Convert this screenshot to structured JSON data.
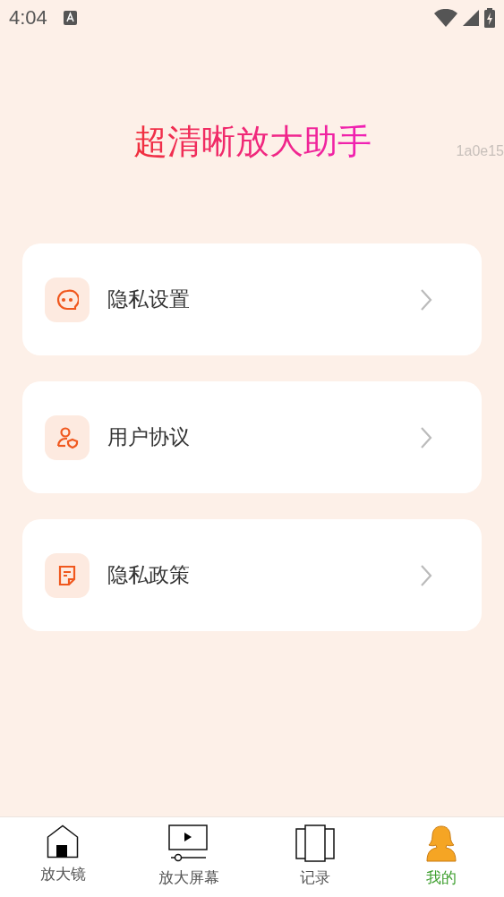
{
  "status_bar": {
    "time": "4:04"
  },
  "title": "超清晰放大助手",
  "version_code": "1a0e15",
  "menu_items": [
    {
      "kind": "chat",
      "label": "隐私设置"
    },
    {
      "kind": "user",
      "label": "用户协议"
    },
    {
      "kind": "document",
      "label": "隐私政策"
    }
  ],
  "tabs": [
    {
      "kind": "home",
      "label": "放大镜",
      "selected": false
    },
    {
      "kind": "screen",
      "label": "放大屏幕",
      "selected": false
    },
    {
      "kind": "pages",
      "label": "记录",
      "selected": false
    },
    {
      "kind": "person",
      "label": "我的",
      "selected": true
    }
  ]
}
